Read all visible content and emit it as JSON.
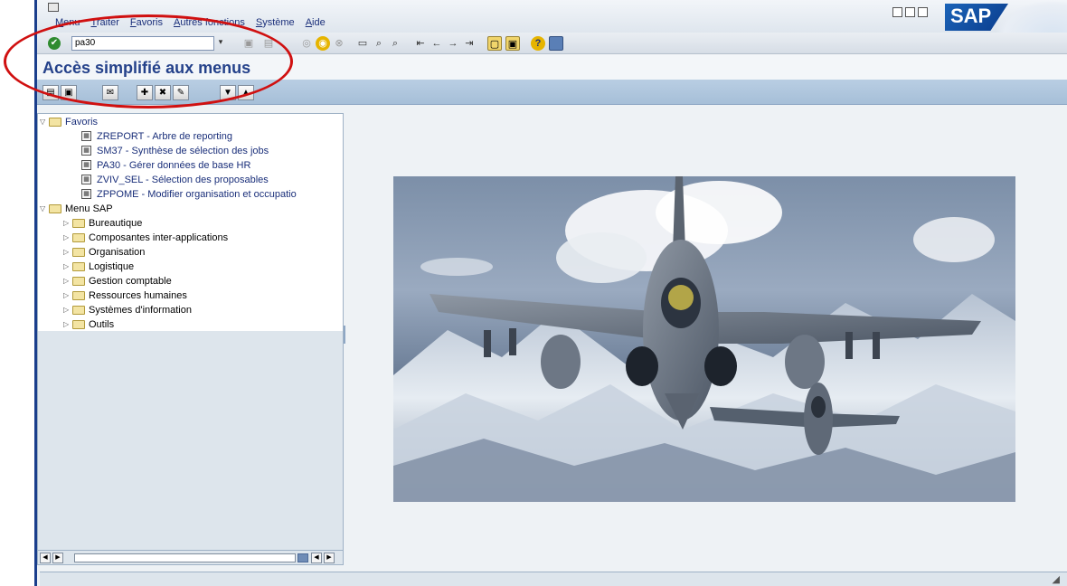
{
  "menubar": {
    "items": [
      {
        "mnemonic": "M",
        "rest": "enu"
      },
      {
        "mnemonic": "T",
        "rest": "raiter"
      },
      {
        "mnemonic": "F",
        "rest": "avoris"
      },
      {
        "mnemonic": "A",
        "rest": "utres fonctions"
      },
      {
        "mnemonic": "S",
        "rest": "ystème"
      },
      {
        "mnemonic": "A",
        "rest": "ide"
      }
    ],
    "logo_text": "SAP"
  },
  "toolbar": {
    "command_value": "pa30",
    "icons": [
      "ok-icon",
      "save-icon",
      "back-icon",
      "exit-icon",
      "cancel-icon",
      "print-icon",
      "find-icon",
      "find-next-icon",
      "first-page-icon",
      "previous-page-icon",
      "next-page-icon",
      "last-page-icon",
      "new-session-icon",
      "shortcut-icon",
      "help-icon",
      "layout-icon"
    ]
  },
  "title": {
    "text": "Accès simplifié aux menus"
  },
  "tree": {
    "favorites": {
      "label": "Favoris",
      "items": [
        "ZREPORT - Arbre de reporting",
        "SM37 - Synthèse de sélection des jobs",
        "PA30 - Gérer données de base HR",
        "ZVIV_SEL - Sélection des proposables",
        "ZPPOME - Modifier organisation et occupatio"
      ]
    },
    "sap_menu": {
      "label": "Menu SAP",
      "items": [
        "Bureautique",
        "Composantes inter-applications",
        "Organisation",
        "Logistique",
        "Gestion comptable",
        "Ressources humaines",
        "Systèmes d'information",
        "Outils"
      ]
    }
  },
  "colors": {
    "annotation": "#d01010",
    "title": "#24418a",
    "app_toolbar": "#a6bfd8"
  }
}
